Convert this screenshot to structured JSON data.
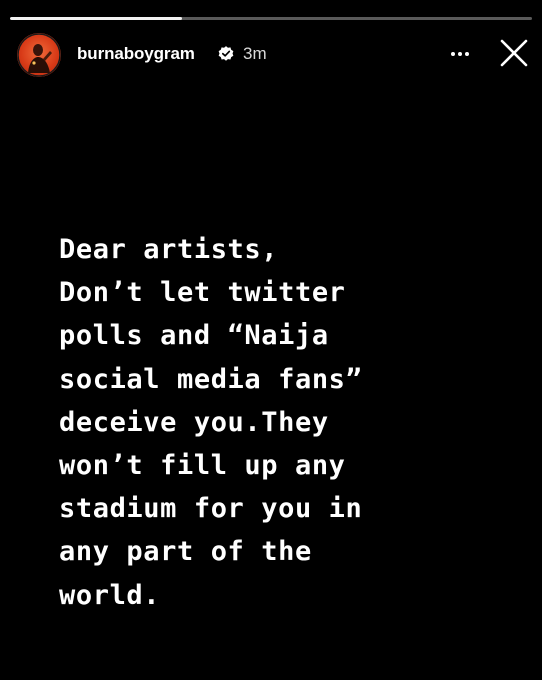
{
  "story": {
    "progress_fraction": 0.33,
    "user": {
      "username": "burnaboygram",
      "verified": true,
      "timestamp": "3m",
      "avatar_icon": "profile-avatar"
    },
    "actions": {
      "more_icon": "more-horizontal-icon",
      "close_icon": "close-icon"
    },
    "text": "Dear artists,\nDon’t let twitter\npolls and “Naija\nsocial media fans”\ndeceive you.They\nwon’t fill up any\nstadium for you in\nany part of the\nworld."
  },
  "colors": {
    "background": "#000000",
    "text": "#ffffff",
    "progress_track": "#5a5a5a",
    "progress_fill": "#f2f2f2",
    "verified_badge": "#ffffff"
  }
}
